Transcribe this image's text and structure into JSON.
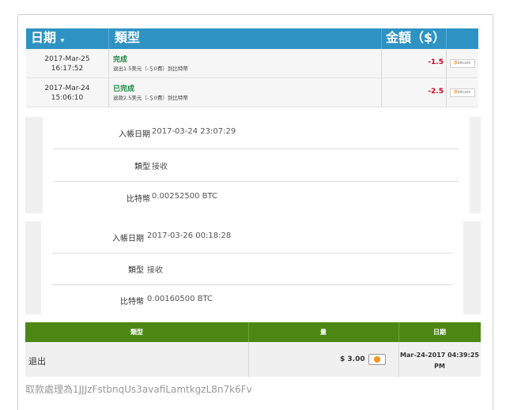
{
  "transactions": {
    "headers": {
      "date": "日期",
      "type": "類型",
      "amount": "金額（$）"
    },
    "rows": [
      {
        "date_line1": "2017-Mar-25",
        "date_line2": "16:17:52",
        "status": "完成",
        "description": "退出1.5美元（-＄0費）到比特幣",
        "amount": "-1.5",
        "method": "bitcoin"
      },
      {
        "date_line1": "2017-Mar-24",
        "date_line2": "15:06:10",
        "status": "已完成",
        "description": "退款2.5美元（-＄0費）到比特幣",
        "amount": "-2.5",
        "method": "bitcoin"
      }
    ]
  },
  "deposit1": {
    "date_label": "入帳日期",
    "date_value": "2017-03-24 23:07:29",
    "type_label": "類型",
    "type_value": "接收",
    "btc_label": "比特幣",
    "btc_value": "0.00252500 BTC"
  },
  "deposit2": {
    "date_label": "入帳日期",
    "date_value": "2017-03-26 00:18:28",
    "type_label": "類型",
    "type_value": "接收",
    "btc_label": "比特幣",
    "btc_value": "0.00160500 BTC"
  },
  "payouts": {
    "headers": {
      "type": "類型",
      "amount": "量",
      "date": "日期"
    },
    "row": {
      "type": "退出",
      "amount": "$ 3.00",
      "date_line1": "Mar-24-2017 04:39:25",
      "date_line2": "PM"
    },
    "address_text": "取款處理為1JJJzFstbnqUs3avafiLamtkgzL8n7k6Fv"
  },
  "colors": {
    "table_header": "#2e93c3",
    "payout_header": "#4c8713",
    "negative_amount": "#d0021b",
    "status_green": "#1a8a3c"
  }
}
